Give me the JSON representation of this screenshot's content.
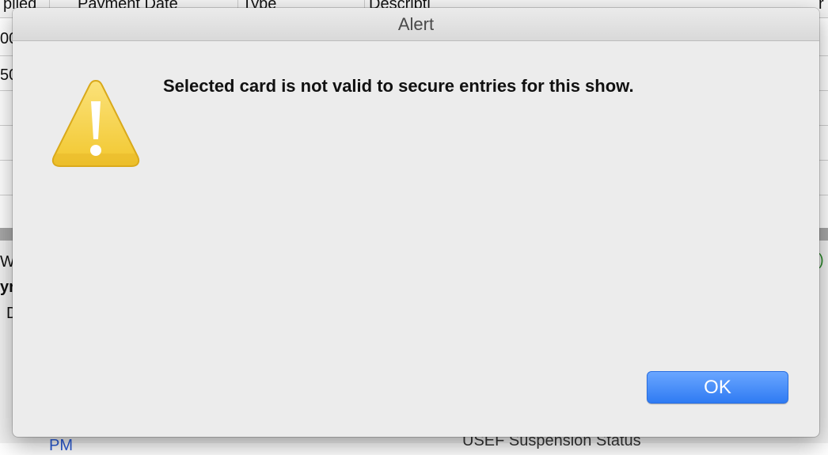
{
  "background_app": {
    "columns": [
      "plied",
      "Payment Date",
      "Type",
      "Descripti"
    ],
    "right_header_fragment": "r",
    "row_fragments": [
      "00",
      "50"
    ],
    "lower_fragments": [
      "W",
      "yr",
      "D"
    ],
    "right_fragment": ")",
    "bottom_fragments": [
      "PM",
      "USEF Suspension Status"
    ]
  },
  "alert": {
    "title": "Alert",
    "icon": "warning-triangle-icon",
    "message": "Selected card is not valid to secure entries for this show.",
    "ok_label": "OK",
    "colors": {
      "button": "#2f7bf3",
      "icon_fill": "#f7d548",
      "window_bg": "#ececec"
    }
  }
}
